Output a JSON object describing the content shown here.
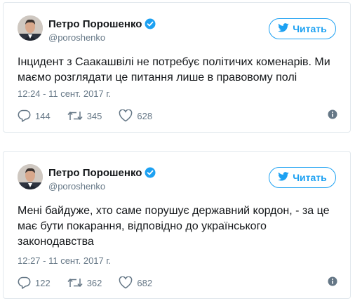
{
  "colors": {
    "accent": "#1da1f2",
    "text": "#14171a",
    "muted": "#657786",
    "border": "#e1e8ed"
  },
  "tweets": [
    {
      "author_name": "Петро Порошенко",
      "handle": "@poroshenko",
      "follow_label": "Читать",
      "text": "Інцидент з Саакашвілі не потребує політичих коменарів. Ми маємо розглядати це питання лише в правовому полі",
      "timestamp": "12:24 - 11 сент. 2017 г.",
      "replies": "144",
      "retweets": "345",
      "likes": "628"
    },
    {
      "author_name": "Петро Порошенко",
      "handle": "@poroshenko",
      "follow_label": "Читать",
      "text": "Мені байдуже, хто саме порушує державний кордон, - за це має бути покарання, відповідно до українського законодавства",
      "timestamp": "12:27 - 11 сент. 2017 г.",
      "replies": "122",
      "retweets": "362",
      "likes": "682"
    }
  ],
  "icons": [
    "verified-badge-icon",
    "bird-icon",
    "reply-icon",
    "retweet-icon",
    "like-icon",
    "info-icon"
  ]
}
